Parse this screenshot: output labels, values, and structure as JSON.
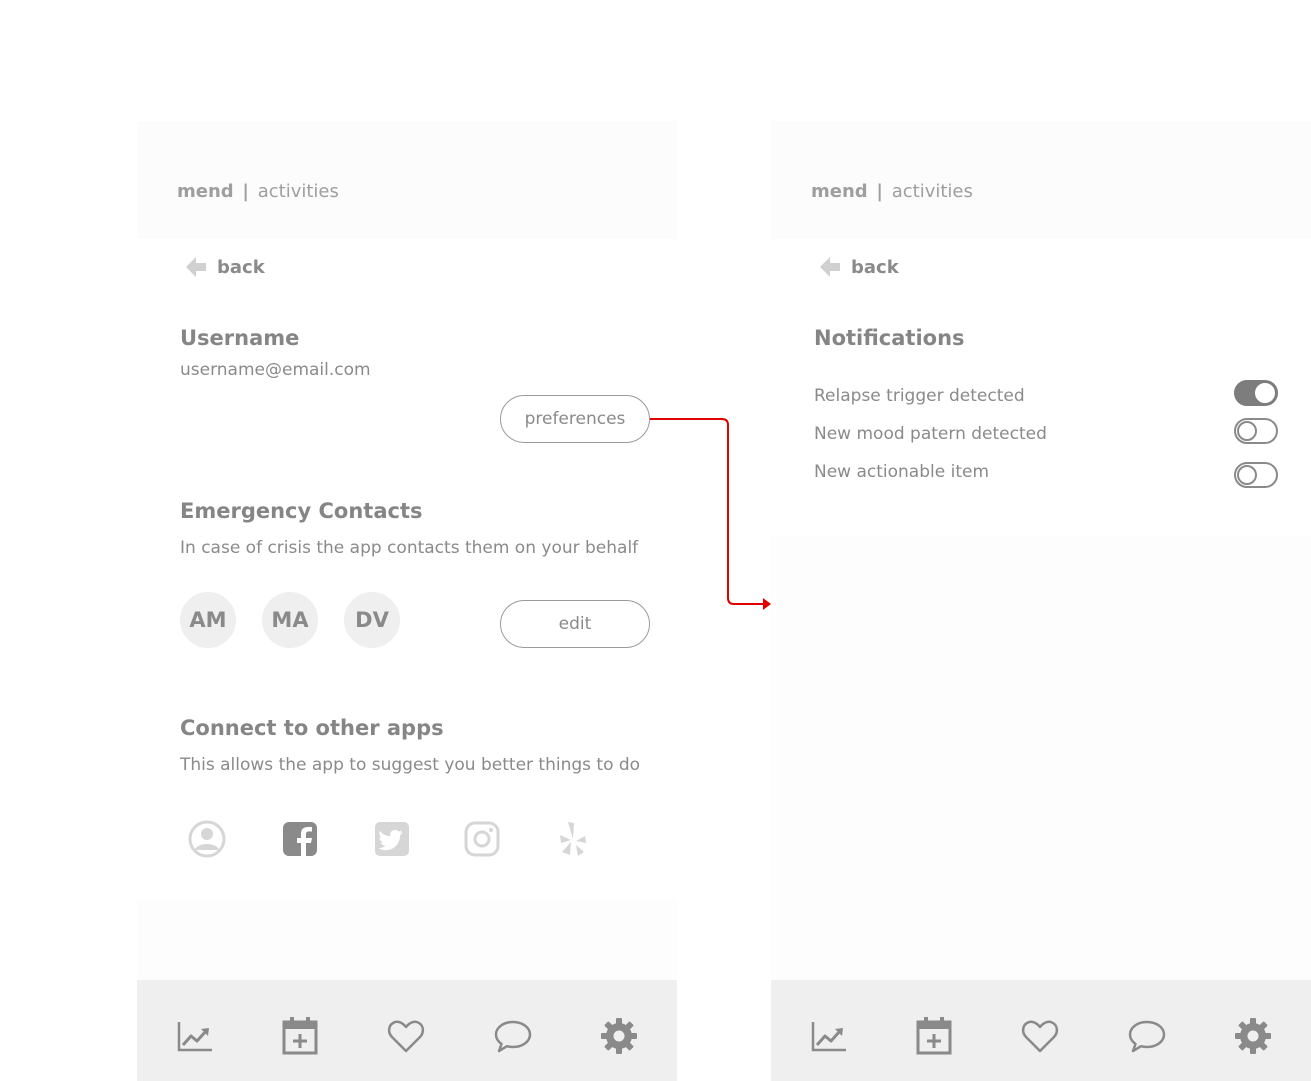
{
  "screens": {
    "left": {
      "brand": {
        "app": "mend",
        "separator": "|",
        "section": "activities"
      },
      "back_label": "back",
      "username": {
        "heading": "Username",
        "email": "username@email.com",
        "button": "preferences"
      },
      "emergency": {
        "heading": "Emergency Contacts",
        "description": "In case of crisis the app contacts them on your behalf",
        "contacts": [
          "AM",
          "MA",
          "DV"
        ],
        "button": "edit"
      },
      "connect": {
        "heading": "Connect to other apps",
        "description": "This allows the app to suggest you better things to do",
        "apps": [
          "user-account-icon",
          "facebook-icon",
          "twitter-icon",
          "instagram-icon",
          "yelp-icon"
        ]
      }
    },
    "right": {
      "brand": {
        "app": "mend",
        "separator": "|",
        "section": "activities"
      },
      "back_label": "back",
      "notifications": {
        "heading": "Notifications",
        "items": [
          {
            "label": "Relapse trigger detected",
            "enabled": true
          },
          {
            "label": "New mood patern detected",
            "enabled": false
          },
          {
            "label": "New actionable item",
            "enabled": false
          }
        ]
      }
    }
  },
  "tabbar": [
    "trend-chart-icon",
    "calendar-add-icon",
    "heart-icon",
    "chat-bubble-icon",
    "gear-icon"
  ],
  "colors": {
    "accent_arrow": "#e00000",
    "text": "#8a8a8a",
    "tabbar_bg": "#efefef",
    "toggle_on": "#7d7d7d"
  }
}
